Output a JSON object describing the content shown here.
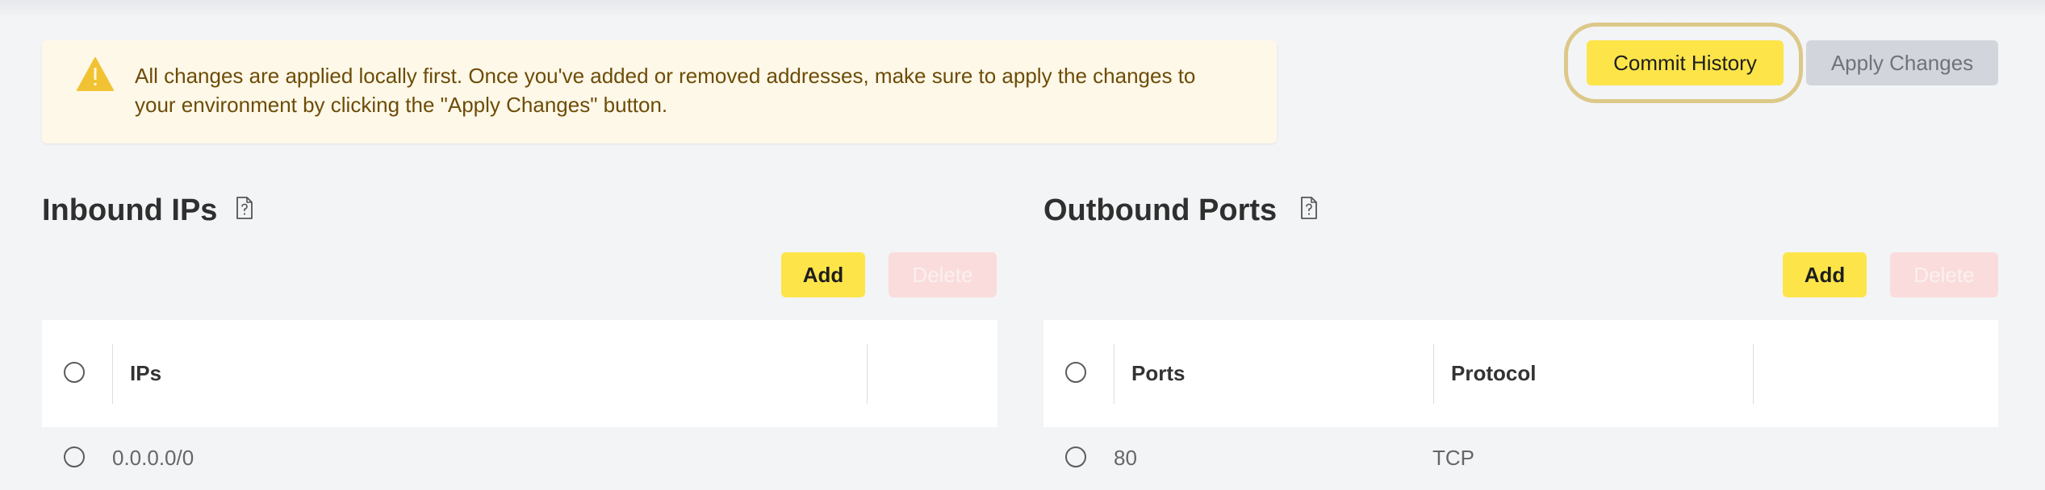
{
  "alert": {
    "icon": "warning-triangle-icon",
    "message": "All changes are applied locally first. Once you've added or removed addresses, make sure to apply the changes to your environment by clicking the \"Apply Changes\" button."
  },
  "toolbar": {
    "commit_history_label": "Commit History",
    "apply_changes_label": "Apply Changes"
  },
  "inbound": {
    "title": "Inbound IPs",
    "doc_icon": "documentation-icon",
    "add_label": "Add",
    "delete_label": "Delete",
    "columns": [
      "IPs",
      ""
    ],
    "rows": [
      {
        "ip": "0.0.0.0/0"
      }
    ]
  },
  "outbound": {
    "title": "Outbound Ports",
    "doc_icon": "documentation-icon",
    "add_label": "Add",
    "delete_label": "Delete",
    "columns": [
      "Ports",
      "Protocol",
      ""
    ],
    "rows": [
      {
        "port": "80",
        "protocol": "TCP"
      }
    ]
  },
  "colors": {
    "accent": "#fde549",
    "alert_bg": "#fef8e8",
    "alert_text": "#6d4c08",
    "disabled_button": "#d2d5db",
    "disabled_delete": "#fadcdc",
    "page_bg": "#f3f4f6"
  }
}
